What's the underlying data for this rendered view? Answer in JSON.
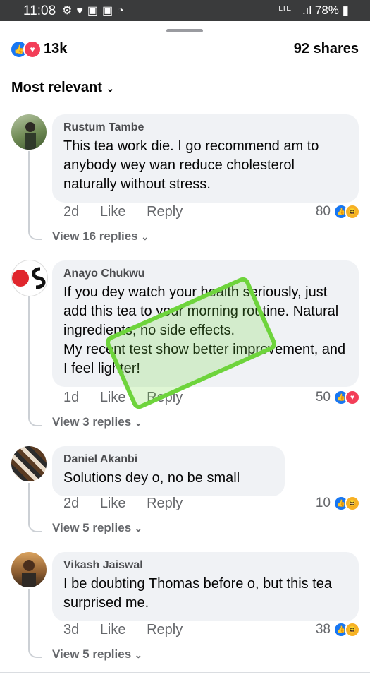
{
  "status_bar": {
    "time": "11:08",
    "network": "LTE",
    "battery": "78%"
  },
  "reactions": {
    "count": "13k",
    "shares": "92 shares"
  },
  "sort_label": "Most relevant",
  "comments": [
    {
      "author": "Rustum Tambe",
      "text": "This tea work die. I go recommend am to anybody wey wan reduce cholesterol naturally without stress.",
      "time": "2d",
      "like": "Like",
      "reply": "Reply",
      "count": "80",
      "replies": "View 16 replies"
    },
    {
      "author": "Anayo Chukwu",
      "text": "If you dey watch your health seriously, just add this tea to your morning routine. Natural ingredients, no side effects.\nMy recent test show better improvement, and I feel lighter!",
      "time": "1d",
      "like": "Like",
      "reply": "Reply",
      "count": "50",
      "replies": "View 3 replies"
    },
    {
      "author": "Daniel Akanbi",
      "text": "Solutions dey o, no be small",
      "time": "2d",
      "like": "Like",
      "reply": "Reply",
      "count": "10",
      "replies": "View 5 replies"
    },
    {
      "author": "Vikash Jaiswal",
      "text": "I be doubting Thomas before o, but this tea surprised me.",
      "time": "3d",
      "like": "Like",
      "reply": "Reply",
      "count": "38",
      "replies": "View 5 replies"
    }
  ],
  "colors": {
    "like": "#1877f2",
    "love": "#f33e58",
    "haha": "#f7b125",
    "sticker": "#6ed43c"
  }
}
